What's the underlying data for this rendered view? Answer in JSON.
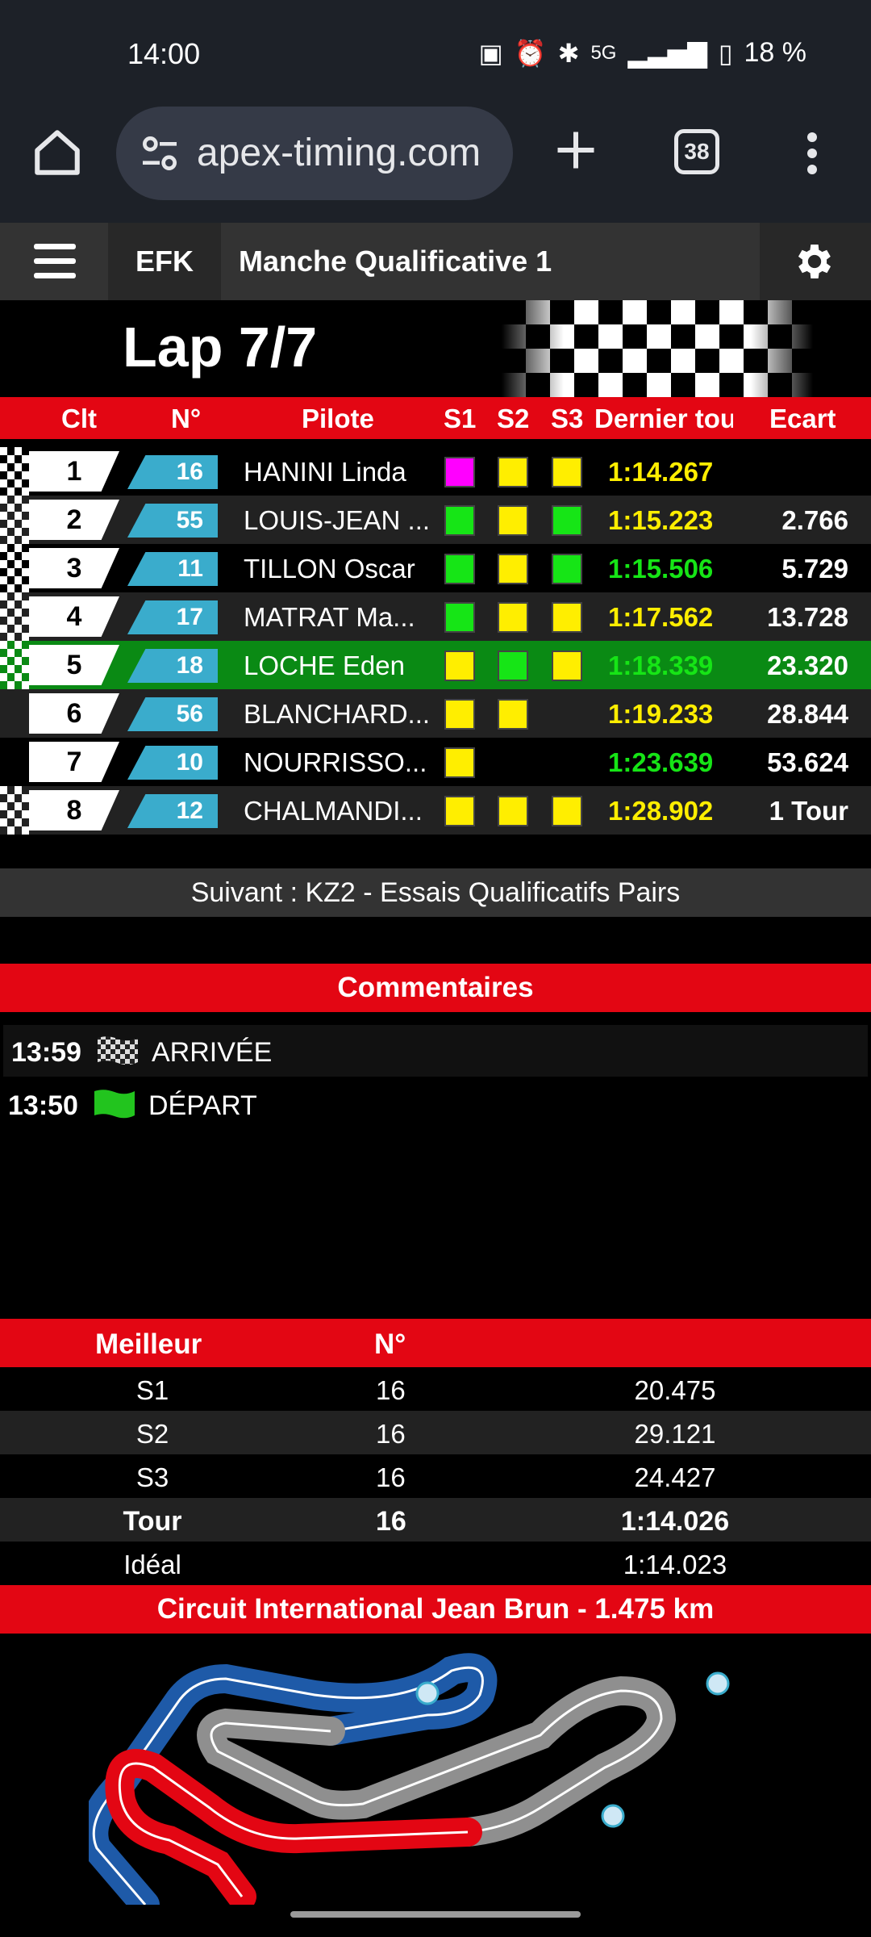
{
  "status_bar": {
    "time": "14:00",
    "network": "5G",
    "battery": "18 %"
  },
  "browser": {
    "url": "apex-timing.com",
    "tab_count": "38"
  },
  "header": {
    "brand": "EFK",
    "session": "Manche Qualificative 1"
  },
  "lap": "Lap 7/7",
  "timing": {
    "columns": {
      "pos": "Clt",
      "num": "N°",
      "pilot": "Pilote",
      "s1": "S1",
      "s2": "S2",
      "s3": "S3",
      "last": "Dernier tou",
      "gap": "Ecart"
    },
    "rows": [
      {
        "pos": "1",
        "num": "16",
        "pilot": "HANINI Linda",
        "s1": "magenta",
        "s2": "yellow",
        "s3": "yellow",
        "last": "1:14.267",
        "last_color": "yellow",
        "gap": "",
        "flag": true
      },
      {
        "pos": "2",
        "num": "55",
        "pilot": "LOUIS-JEAN ...",
        "s1": "green",
        "s2": "yellow",
        "s3": "green",
        "last": "1:15.223",
        "last_color": "yellow",
        "gap": "2.766",
        "flag": true
      },
      {
        "pos": "3",
        "num": "11",
        "pilot": "TILLON Oscar",
        "s1": "green",
        "s2": "yellow",
        "s3": "green",
        "last": "1:15.506",
        "last_color": "green",
        "gap": "5.729",
        "flag": true
      },
      {
        "pos": "4",
        "num": "17",
        "pilot": "MATRAT Ma...",
        "s1": "green",
        "s2": "yellow",
        "s3": "yellow",
        "last": "1:17.562",
        "last_color": "yellow",
        "gap": "13.728",
        "flag": true
      },
      {
        "pos": "5",
        "num": "18",
        "pilot": "LOCHE Eden",
        "s1": "yellow",
        "s2": "green",
        "s3": "yellow",
        "last": "1:18.339",
        "last_color": "green",
        "gap": "23.320",
        "flag": true
      },
      {
        "pos": "6",
        "num": "56",
        "pilot": "BLANCHARD...",
        "s1": "yellow",
        "s2": "yellow",
        "s3": "",
        "last": "1:19.233",
        "last_color": "yellow",
        "gap": "28.844",
        "flag": false
      },
      {
        "pos": "7",
        "num": "10",
        "pilot": "NOURRISSO...",
        "s1": "yellow",
        "s2": "",
        "s3": "",
        "last": "1:23.639",
        "last_color": "green",
        "gap": "53.624",
        "flag": false
      },
      {
        "pos": "8",
        "num": "12",
        "pilot": "CHALMANDI...",
        "s1": "yellow",
        "s2": "yellow",
        "s3": "yellow",
        "last": "1:28.902",
        "last_color": "yellow",
        "gap": "1 Tour",
        "flag": true
      }
    ]
  },
  "next_session": "Suivant : KZ2 - Essais Qualificatifs Pairs",
  "comments": {
    "title": "Commentaires",
    "items": [
      {
        "time": "13:59",
        "icon": "checkered-flag-icon",
        "text": "ARRIVÉE"
      },
      {
        "time": "13:50",
        "icon": "green-flag-icon",
        "text": "DÉPART"
      }
    ]
  },
  "best": {
    "col_label": "Meilleur",
    "col_num": "N°",
    "rows": [
      {
        "label": "S1",
        "num": "16",
        "time": "20.475"
      },
      {
        "label": "S2",
        "num": "16",
        "time": "29.121"
      },
      {
        "label": "S3",
        "num": "16",
        "time": "24.427"
      },
      {
        "label": "Tour",
        "num": "16",
        "time": "1:14.026"
      },
      {
        "label": "Idéal",
        "num": "",
        "time": "1:14.023"
      }
    ]
  },
  "circuit": {
    "title": "Circuit International Jean Brun - 1.475 km"
  },
  "colors": {
    "accent_red": "#e30613",
    "best_magenta": "#ff00ff",
    "personal_green": "#16e516",
    "sector_yellow": "#ffee00",
    "number_blue": "#3aaccc",
    "highlight_green": "#0a8a14"
  }
}
